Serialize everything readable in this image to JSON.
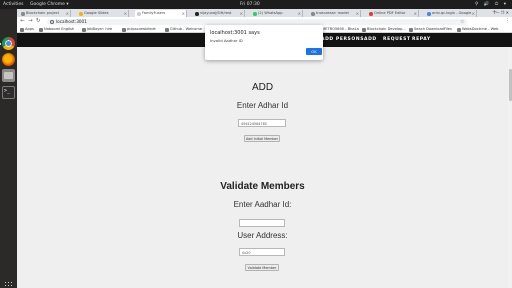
{
  "topbar": {
    "activities": "Activities",
    "app_menu": "Google Chrome ▾",
    "clock": "Fri 07:30",
    "tray": "⚲ 🔊 ⏻ ▾"
  },
  "browser": {
    "tabs": [
      {
        "label": "Blockchain project"
      },
      {
        "label": "Google Slides"
      },
      {
        "label": "FamilyFusers"
      },
      {
        "label": "vijayuvaj/SIH/rest"
      },
      {
        "label": "(2) WhatsApp"
      },
      {
        "label": "truecaesar: model"
      },
      {
        "label": "Online PDF Editor"
      },
      {
        "label": "antv.qc.login - Google"
      }
    ],
    "active_tab_index": 2,
    "new_tab": "+",
    "window_controls": "— ❐ ✕",
    "url": "localhost:3001",
    "bookmarks": [
      "Apps",
      "Naboomi English",
      "JobBayer: hire",
      "pulpscrewbitnet",
      "Github - Welcome",
      "GitHub - blockchain",
      "GitHub",
      "Hyperledger Fabric",
      "METRO5690 - BhaLa",
      "Blockchain Develop...",
      "Seach DownloadFiles",
      "WebsDoctrine - Web"
    ]
  },
  "site_nav": {
    "items": [
      "ADD PERSONS",
      "ADD",
      "REQUEST",
      "REPAY"
    ]
  },
  "add_section": {
    "title": "ADD",
    "field_label": "Enter Adhar Id",
    "field_value": "456124564785",
    "button": "Add Initial Member"
  },
  "validate_section": {
    "title": "Validate Members",
    "aadhar_label": "Enter Aadhar Id:",
    "aadhar_value": "",
    "address_label": "User Address:",
    "address_value": "0x20",
    "button": "Validate Member"
  },
  "alert": {
    "title": "localhost:3001 says",
    "message": "Invalid Aadhar ID",
    "ok": "OK"
  },
  "colors": {
    "nav_bg": "#131313",
    "page_bg": "#efefef",
    "alert_ok": "#1a73e8"
  }
}
